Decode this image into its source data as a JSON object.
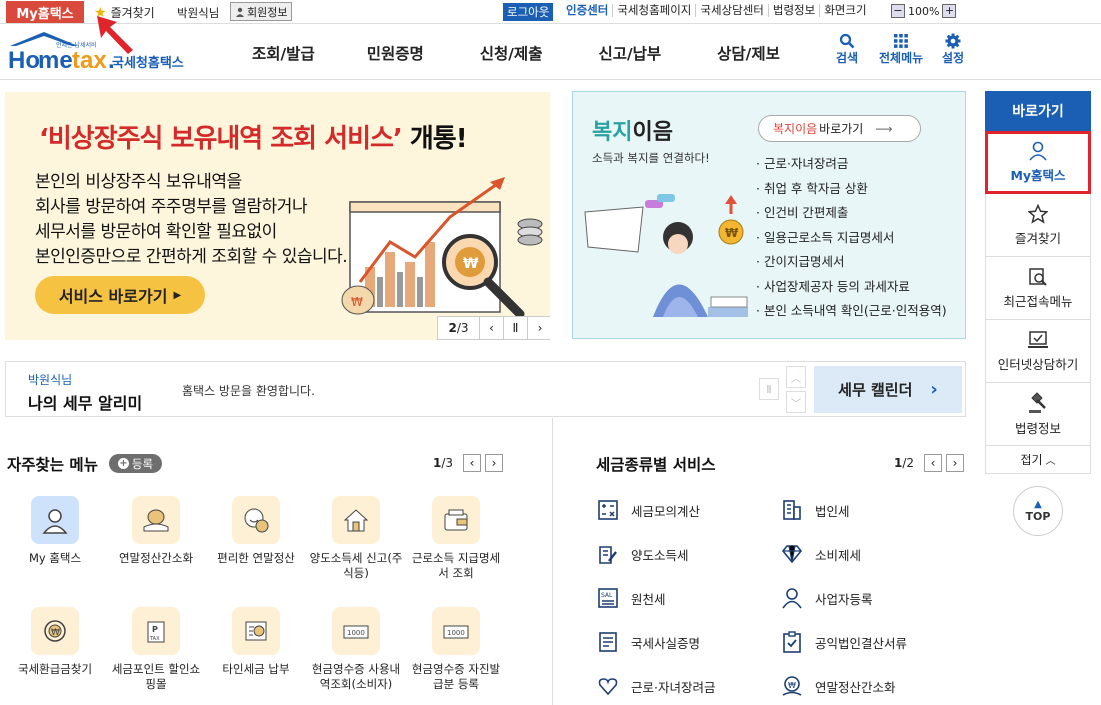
{
  "topbar": {
    "my_hometax": "My홈택스",
    "favorites": "즐겨찾기",
    "user": "박원식님",
    "member_info": "회원정보",
    "logout": "로그아웃",
    "links": [
      "인증센터",
      "국세청홈페이지",
      "국세상담센터",
      "법령정보",
      "화면크기"
    ],
    "zoom_value": "100%",
    "zoom_minus": "−",
    "zoom_plus": "+"
  },
  "header": {
    "logo_text": "Hometax",
    "logo_tagline": "언제든 납세서비",
    "site_name": "국세청홈택스",
    "nav": [
      "조회/발급",
      "민원증명",
      "신청/제출",
      "신고/납부",
      "상담/제보"
    ],
    "util": [
      {
        "label": "검색",
        "icon": "search-icon"
      },
      {
        "label": "전체메뉴",
        "icon": "grid-menu-icon"
      },
      {
        "label": "설정",
        "icon": "gear-icon"
      }
    ]
  },
  "banner_main": {
    "title_red": "‘비상장주식 보유내역 조회 서비스’",
    "title_rest": " 개통!",
    "desc": [
      "본인의 비상장주식 보유내역을",
      "회사를 방문하여 주주명부를 열람하거나",
      "세무서를 방문하여 확인할 필요없이",
      "본인인증만으로 간편하게 조회할 수 있습니다."
    ],
    "button": "서비스 바로가기",
    "page_current": "2",
    "page_total": "/3",
    "pause_label": "Ⅱ",
    "prev_label": "‹",
    "next_label": "›"
  },
  "banner_welfare": {
    "title_colored": "복지",
    "title_rest": "이음",
    "subtitle": "소득과 복지를 연결하다!",
    "link_colored": "복지이음",
    "link_rest": " 바로가기",
    "items": [
      "근로·자녀장려금",
      "취업 후 학자금 상환",
      "인건비 간편제출",
      "일용근로소득 지급명세서",
      "간이지급명세서",
      "사업장제공자 등의 과세자료",
      "본인 소득내역 확인(근로·인적용역)"
    ]
  },
  "notice": {
    "user": "박원식님",
    "title": "나의 세무 알리미",
    "message": "홈택스 방문을 환영합니다.",
    "calendar": "세무 캘린더",
    "calendar_arrow": "›"
  },
  "favorites_menu": {
    "title": "자주찾는 메뉴",
    "add": "등록",
    "page_current": "1",
    "page_total": "/3",
    "items": [
      {
        "label": "My 홈택스",
        "icon": "person-icon"
      },
      {
        "label": "연말정산간소화",
        "icon": "money-hand-icon"
      },
      {
        "label": "편리한 연말정산",
        "icon": "smile-coin-icon"
      },
      {
        "label": "양도소득세 신고(주식등)",
        "icon": "house-pen-icon"
      },
      {
        "label": "근로소득 지급명세서 조회",
        "icon": "wallet-icon"
      },
      {
        "label": "국세환급금찾기",
        "icon": "coin-refresh-icon"
      },
      {
        "label": "세금포인트 할인쇼핑몰",
        "icon": "tax-bag-icon"
      },
      {
        "label": "타인세금 납부",
        "icon": "bill-pay-icon"
      },
      {
        "label": "현금영수증 사용내역조회(소비자)",
        "icon": "receipt-icon"
      },
      {
        "label": "현금영수증 자진발급분 등록",
        "icon": "receipt-register-icon"
      }
    ]
  },
  "tax_services": {
    "title": "세금종류별 서비스",
    "page_current": "1",
    "page_total": "/2",
    "items": [
      {
        "label": "세금모의계산",
        "icon": "calculator-icon"
      },
      {
        "label": "법인세",
        "icon": "building-icon"
      },
      {
        "label": "양도소득세",
        "icon": "document-pen-icon"
      },
      {
        "label": "소비제세",
        "icon": "diamond-icon"
      },
      {
        "label": "원천세",
        "icon": "salary-icon"
      },
      {
        "label": "사업자등록",
        "icon": "business-person-icon"
      },
      {
        "label": "국세사실증명",
        "icon": "certificate-icon"
      },
      {
        "label": "공익법인결산서류",
        "icon": "clipboard-check-icon"
      },
      {
        "label": "근로·자녀장려금",
        "icon": "heart-hand-icon"
      },
      {
        "label": "연말정산간소화",
        "icon": "money-hand-icon"
      }
    ]
  },
  "sidebar": {
    "title": "바로가기",
    "items": [
      {
        "label": "My홈택스",
        "icon": "person-icon",
        "active": true
      },
      {
        "label": "즐겨찾기",
        "icon": "star-icon"
      },
      {
        "label": "최근접속메뉴",
        "icon": "recent-search-icon"
      },
      {
        "label": "인터넷상담하기",
        "icon": "laptop-check-icon"
      },
      {
        "label": "법령정보",
        "icon": "gavel-icon"
      }
    ],
    "fold": "접기",
    "top": "TOP"
  },
  "colors": {
    "primary": "#1b5fb5",
    "my_tab": "#d94a3c",
    "highlight_border": "#e0242c",
    "banner_yellow": "#fdf5dc",
    "banner_teal": "#e8f6f8"
  }
}
